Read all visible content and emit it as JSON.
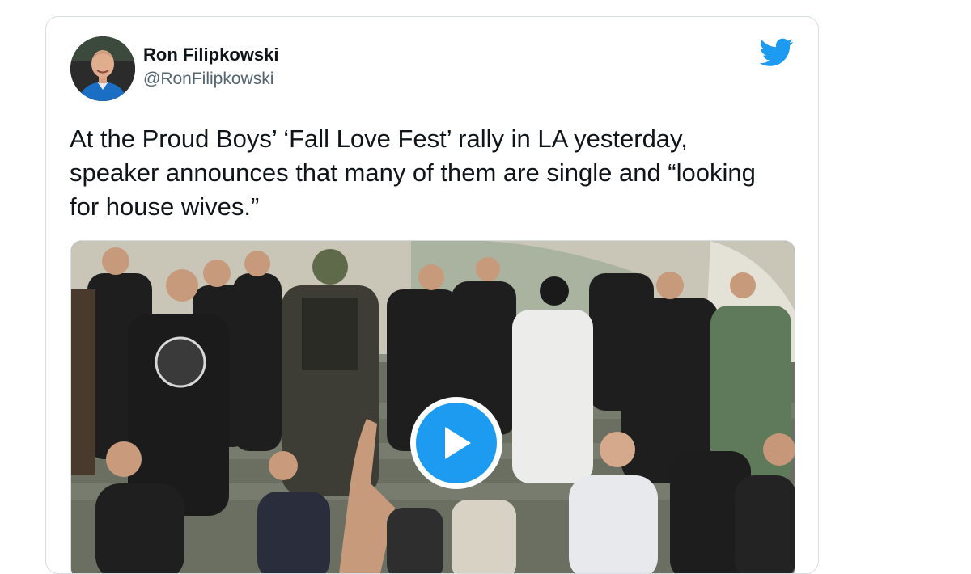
{
  "tweet": {
    "author": {
      "display_name": "Ron Filipkowski",
      "handle": "@RonFilipkowski"
    },
    "text": "At the Proud Boys’ ‘Fall Love Fest’ rally in LA yesterday, speaker announces that many of them are single and “looking for house wives.”",
    "logo_icon": "twitter-bird-icon",
    "media": {
      "type": "video",
      "play_icon": "play-icon"
    }
  },
  "colors": {
    "twitter_blue": "#1d9bf0",
    "text_primary": "#0f1419",
    "text_secondary": "#536471",
    "border": "#d6dde3"
  }
}
